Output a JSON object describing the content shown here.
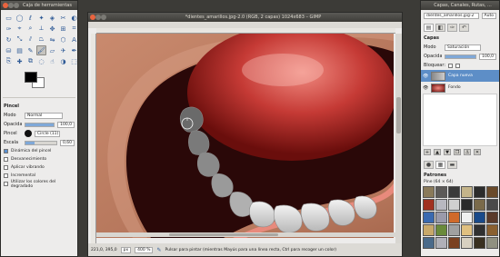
{
  "toolbox": {
    "title": "Caja de herramientas",
    "tools": [
      "rect-select-icon",
      "ellipse-select-icon",
      "lasso-icon",
      "fuzzy-select-icon",
      "color-select-icon",
      "scissors-icon",
      "foreground-select-icon",
      "paths-icon",
      "color-picker-icon",
      "zoom-icon",
      "measure-icon",
      "move-icon",
      "align-icon",
      "crop-icon",
      "rotate-icon",
      "scale-icon",
      "shear-icon",
      "perspective-icon",
      "flip-icon",
      "cage-icon",
      "text-icon",
      "bucket-fill-icon",
      "blend-icon",
      "pencil-icon",
      "paintbrush-icon",
      "eraser-icon",
      "airbrush-icon",
      "ink-icon",
      "clone-icon",
      "heal-icon",
      "perspective-clone-icon",
      "blur-icon",
      "smudge-icon",
      "dodge-burn-icon",
      "unified-transform-icon"
    ],
    "selected_tool": 24,
    "brush_panel": {
      "title": "Pincel",
      "mode_label": "Modo",
      "mode_value": "Normal",
      "opacity_label": "Opacidad",
      "opacity_value": "100,0",
      "opacity_fraction": 1.0,
      "brush_label": "Pincel",
      "brush_value": "Circle (11)",
      "size_label": "Escala",
      "size_value": "0,60",
      "size_fraction": 0.3,
      "options": [
        {
          "label": "Dinámica del pincel",
          "checked": true
        },
        {
          "label": "Desvanecimiento",
          "checked": false
        },
        {
          "label": "Aplicar vibrando",
          "checked": false
        },
        {
          "label": "Incremental",
          "checked": false
        },
        {
          "label": "Utilizar los colores del degradado",
          "checked": false
        }
      ]
    }
  },
  "canvas": {
    "title": "*dientes_amarillos.jpg-2.0 (RGB, 2 capas) 1024x683 – GIMP",
    "status": {
      "coords": "221,0, 395,0",
      "unit": "px",
      "zoom": "400 %",
      "message": "Pulsar para pintar (mientras Mayús para una línea recta, Ctrl para recoger un color)"
    }
  },
  "layers": {
    "title": "Capas, Canales, Rutas, ...",
    "image_selector": "dientes_amarillos.jpg-2",
    "auto_label": "Auto",
    "panel_title": "Capas",
    "mode_label": "Modo",
    "mode_value": "Saturación",
    "opacity_label": "Opacidad",
    "opacity_value": "100,0",
    "opacity_fraction": 1.0,
    "lock_label": "Bloquear:",
    "list": [
      {
        "name": "Capa nueva",
        "selected": true
      },
      {
        "name": "Fondo",
        "selected": false
      }
    ],
    "patterns_title": "Patrones",
    "patterns_sub": "Pine (64 × 64)",
    "pattern_colors": [
      "#8a7a5a",
      "#5c5a58",
      "#3a3a3a",
      "#c4b48a",
      "#2c2c2c",
      "#6a4a2a",
      "#a03020",
      "#b8b8c0",
      "#d0d0d0",
      "#2a2a2a",
      "#7a6a4a",
      "#4a4a4a",
      "#3a6ab0",
      "#9a9aaa",
      "#d06a2a",
      "#f0f0f0",
      "#1a4a8a",
      "#5a3a2a",
      "#c8a86a",
      "#6a8a3a",
      "#a0a0a0",
      "#e0c080",
      "#303030",
      "#8a6030",
      "#4a6a8a",
      "#b0b0b8",
      "#7a4020",
      "#d8d0c0",
      "#3a3020",
      "#909080"
    ]
  },
  "colors": {
    "accent": "#5d8ec7",
    "title_bar": "#3e3d39",
    "close_button": "#e9643f"
  }
}
